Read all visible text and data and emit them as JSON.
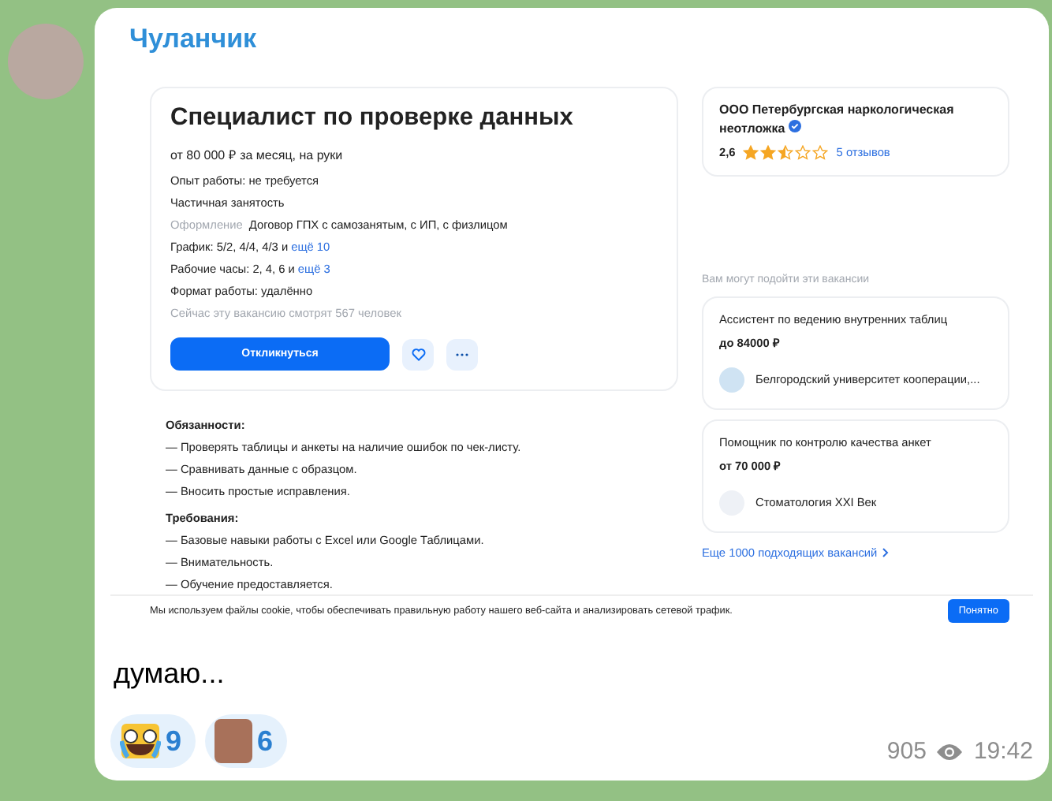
{
  "message": {
    "sender": "Чуланчик",
    "text": "думаю...",
    "views": "905",
    "time": "19:42",
    "reactions": [
      {
        "kind": "emoji",
        "count": "9"
      },
      {
        "kind": "photo",
        "count": "6"
      }
    ]
  },
  "screenshot": {
    "vacancy": {
      "title": "Специалист по проверке данных",
      "salary": "от 80 000 ₽ за месяц, на руки",
      "details": [
        {
          "kind": "plain",
          "text": "Опыт работы: не требуется"
        },
        {
          "kind": "plain",
          "text": "Частичная занятость"
        },
        {
          "kind": "labeled",
          "label": "Оформление",
          "text": "Договор ГПХ с самозанятым, с ИП, с физлицом"
        },
        {
          "kind": "link",
          "text": "График: 5/2, 4/4, 4/3 и",
          "link": "ещё 10"
        },
        {
          "kind": "link",
          "text": "Рабочие часы: 2, 4, 6 и",
          "link": "ещё 3"
        },
        {
          "kind": "plain",
          "text": "Формат работы: удалённо"
        },
        {
          "kind": "muted",
          "text": "Сейчас эту вакансию смотрят 567 человек"
        }
      ],
      "apply_button": "Откликнуться"
    },
    "description": [
      {
        "heading": "Обязанности:",
        "items": [
          "— Проверять таблицы и анкеты на наличие ошибок по чек-листу.",
          "— Сравнивать данные с образцом.",
          "— Вносить простые исправления."
        ]
      },
      {
        "heading": "Требования:",
        "items": [
          "— Базовые навыки работы с Excel или Google Таблицами.",
          "— Внимательность.",
          "— Обучение предоставляется."
        ]
      }
    ],
    "company": {
      "name": "ООО Петербургская наркологическая неотложка",
      "rating": "2,6",
      "stars": 2.5,
      "reviews": "5 отзывов"
    },
    "suggestions_heading": "Вам могут подойти эти вакансии",
    "suggestions": [
      {
        "title": "Ассистент по ведению внутренних таблиц",
        "salary": "до 84000 ₽",
        "employer": "Белгородский университет кооперации,..."
      },
      {
        "title": "Помощник по контролю качества анкет",
        "salary": "от 70 000 ₽",
        "employer": "Стоматология XXI Век"
      }
    ],
    "more_link": "Еще 1000 подходящих вакансий",
    "cookie_banner": {
      "text": "Мы используем файлы cookie, чтобы обеспечивать правильную работу нашего веб-сайта и анализировать сетевой трафик.",
      "button": "Понятно"
    }
  }
}
